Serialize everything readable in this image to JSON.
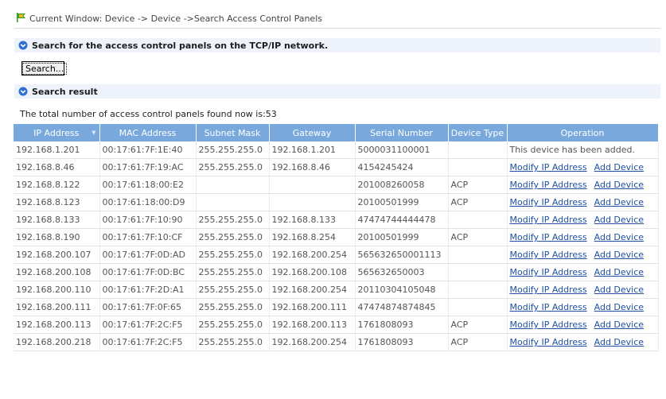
{
  "breadcrumb": "Current Window: Device -> Device ->Search Access Control Panels",
  "search_section": {
    "title": "Search for the access control panels on the TCP/IP network."
  },
  "search_button": "Search...",
  "result_section": {
    "title": "Search result"
  },
  "summary": "The total number of access control panels found now is:53",
  "table": {
    "columns": [
      "IP Address",
      "MAC Address",
      "Subnet Mask",
      "Gateway",
      "Serial Number",
      "Device Type",
      "Operation"
    ],
    "rows": [
      {
        "ip": "192.168.1.201",
        "mac": "00:17:61:7F:1E:40",
        "mask": "255.255.255.0",
        "gateway": "192.168.1.201",
        "serial": "5000031100001",
        "type": "",
        "added": "This device has been added."
      },
      {
        "ip": "192.168.8.46",
        "mac": "00:17:61:7F:19:AC",
        "mask": "255.255.255.0",
        "gateway": "192.168.8.46",
        "serial": "4154245424",
        "type": "",
        "modify": "Modify IP Address",
        "add": "Add Device"
      },
      {
        "ip": "192.168.8.122",
        "mac": "00:17:61:18:00:E2",
        "mask": "",
        "gateway": "",
        "serial": "201008260058",
        "type": "ACP",
        "modify": "Modify IP Address",
        "add": "Add Device"
      },
      {
        "ip": "192.168.8.123",
        "mac": "00:17:61:18:00:D9",
        "mask": "",
        "gateway": "",
        "serial": "20100501999",
        "type": "ACP",
        "modify": "Modify IP Address",
        "add": "Add Device"
      },
      {
        "ip": "192.168.8.133",
        "mac": "00:17:61:7F:10:90",
        "mask": "255.255.255.0",
        "gateway": "192.168.8.133",
        "serial": "47474744444478",
        "type": "",
        "modify": "Modify IP Address",
        "add": "Add Device"
      },
      {
        "ip": "192.168.8.190",
        "mac": "00:17:61:7F:10:CF",
        "mask": "255.255.255.0",
        "gateway": "192.168.8.254",
        "serial": "20100501999",
        "type": "ACP",
        "modify": "Modify IP Address",
        "add": "Add Device"
      },
      {
        "ip": "192.168.200.107",
        "mac": "00:17:61:7F:0D:AD",
        "mask": "255.255.255.0",
        "gateway": "192.168.200.254",
        "serial": "565632650001113",
        "type": "",
        "modify": "Modify IP Address",
        "add": "Add Device"
      },
      {
        "ip": "192.168.200.108",
        "mac": "00:17:61:7F:0D:BC",
        "mask": "255.255.255.0",
        "gateway": "192.168.200.108",
        "serial": "565632650003",
        "type": "",
        "modify": "Modify IP Address",
        "add": "Add Device"
      },
      {
        "ip": "192.168.200.110",
        "mac": "00:17:61:7F:2D:A1",
        "mask": "255.255.255.0",
        "gateway": "192.168.200.254",
        "serial": "20110304105048",
        "type": "",
        "modify": "Modify IP Address",
        "add": "Add Device"
      },
      {
        "ip": "192.168.200.111",
        "mac": "00:17:61:7F:0F:65",
        "mask": "255.255.255.0",
        "gateway": "192.168.200.111",
        "serial": "47474874874845",
        "type": "",
        "modify": "Modify IP Address",
        "add": "Add Device"
      },
      {
        "ip": "192.168.200.113",
        "mac": "00:17:61:7F:2C:F5",
        "mask": "255.255.255.0",
        "gateway": "192.168.200.113",
        "serial": "1761808093",
        "type": "ACP",
        "modify": "Modify IP Address",
        "add": "Add Device"
      },
      {
        "ip": "192.168.200.218",
        "mac": "00:17:61:7F:2C:F5",
        "mask": "255.255.255.0",
        "gateway": "192.168.200.254",
        "serial": "1761808093",
        "type": "ACP",
        "modify": "Modify IP Address",
        "add": "Add Device"
      }
    ]
  },
  "colors": {
    "header_bg": "#79a9dc",
    "section_bg": "#eef2fb",
    "link": "#1f4fa3",
    "flag_green": "#3a9a22",
    "flag_yellow": "#f3c21d"
  },
  "icons": {
    "breadcrumb": "flag-icon",
    "section": "chevron-down-circle-icon",
    "sort": "sort-icon"
  }
}
